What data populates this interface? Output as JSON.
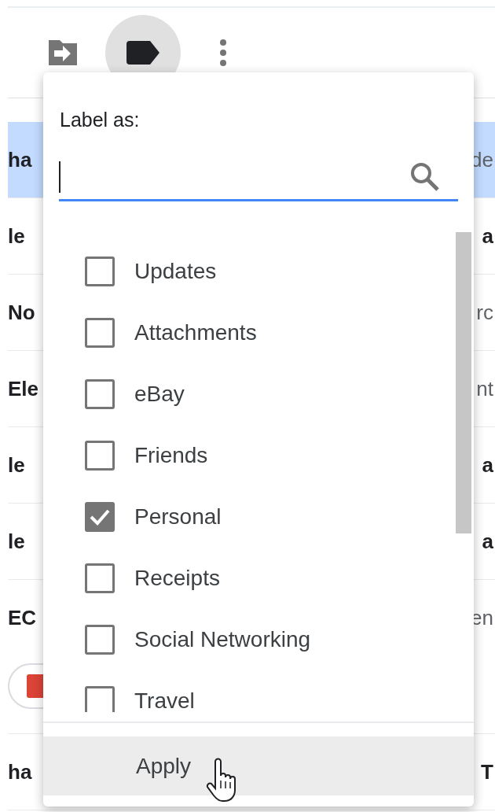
{
  "toolbar": {
    "buttons": [
      {
        "kind": "move",
        "active": false
      },
      {
        "kind": "label",
        "active": true
      },
      {
        "kind": "more",
        "active": false
      }
    ]
  },
  "messages": [
    {
      "sender": "ha",
      "right": "de",
      "unread": false,
      "selected": true,
      "attachment": false
    },
    {
      "sender": "le",
      "right": "a",
      "unread": true,
      "selected": false,
      "attachment": false
    },
    {
      "sender": "No",
      "right": "rc",
      "unread": false,
      "selected": false,
      "attachment": false
    },
    {
      "sender": "Ele",
      "right": "nt",
      "unread": false,
      "selected": false,
      "attachment": false
    },
    {
      "sender": "le",
      "right": "a",
      "unread": true,
      "selected": false,
      "attachment": false
    },
    {
      "sender": "le",
      "right": "a",
      "unread": true,
      "selected": false,
      "attachment": false
    },
    {
      "sender": "EC",
      "right": "en",
      "unread": false,
      "selected": false,
      "attachment": true
    },
    {
      "sender": "ha",
      "right": "T",
      "unread": true,
      "selected": false,
      "attachment": false
    }
  ],
  "label_menu": {
    "title": "Label as:",
    "search": {
      "focused": true
    },
    "labels": [
      {
        "label": "Updates",
        "checked": false
      },
      {
        "label": "Attachments",
        "checked": false
      },
      {
        "label": "eBay",
        "checked": false
      },
      {
        "label": "Friends",
        "checked": false
      },
      {
        "label": "Personal",
        "checked": true
      },
      {
        "label": "Receipts",
        "checked": false
      },
      {
        "label": "Social Networking",
        "checked": false
      },
      {
        "label": "Travel",
        "checked": false
      }
    ],
    "apply": {
      "label": "Apply",
      "hovered": true
    }
  }
}
